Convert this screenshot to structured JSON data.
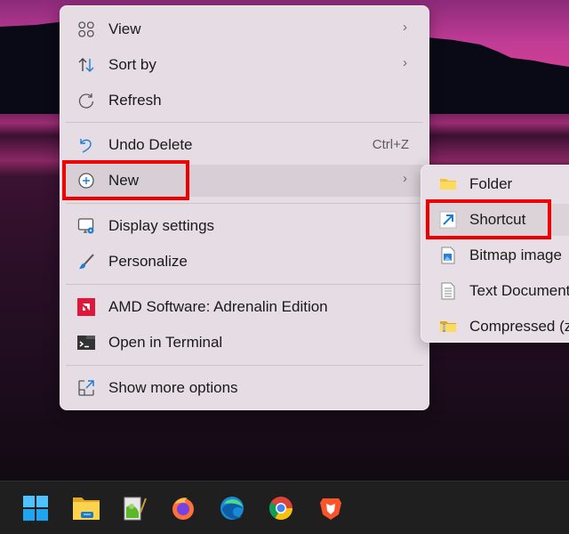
{
  "context_menu": {
    "items": [
      {
        "label": "View",
        "icon": "grid-icon",
        "has_submenu": true
      },
      {
        "label": "Sort by",
        "icon": "sort-icon",
        "has_submenu": true
      },
      {
        "label": "Refresh",
        "icon": "refresh-icon",
        "has_submenu": false
      },
      {
        "label": "Undo Delete",
        "icon": "undo-icon",
        "shortcut": "Ctrl+Z"
      },
      {
        "label": "New",
        "icon": "plus-circle-icon",
        "has_submenu": true,
        "highlighted": true
      },
      {
        "label": "Display settings",
        "icon": "display-settings-icon"
      },
      {
        "label": "Personalize",
        "icon": "brush-icon"
      },
      {
        "label": "AMD Software: Adrenalin Edition",
        "icon": "amd-icon"
      },
      {
        "label": "Open in Terminal",
        "icon": "terminal-icon"
      },
      {
        "label": "Show more options",
        "icon": "show-more-icon"
      }
    ],
    "chevron": "›"
  },
  "new_submenu": {
    "items": [
      {
        "label": "Folder",
        "icon": "folder-icon"
      },
      {
        "label": "Shortcut",
        "icon": "shortcut-icon",
        "highlighted": true
      },
      {
        "label": "Bitmap image",
        "icon": "bitmap-icon"
      },
      {
        "label": "Text Document",
        "icon": "text-document-icon"
      },
      {
        "label": "Compressed (zipped) Folder",
        "icon": "zip-folder-icon"
      }
    ]
  },
  "taskbar": {
    "icons": [
      "start-icon",
      "file-explorer-icon",
      "notepad-plus-plus-icon",
      "firefox-icon",
      "edge-icon",
      "chrome-icon",
      "brave-icon"
    ]
  },
  "colors": {
    "highlight_box": "#ee0000",
    "accent_blue": "#0f6cbd"
  }
}
